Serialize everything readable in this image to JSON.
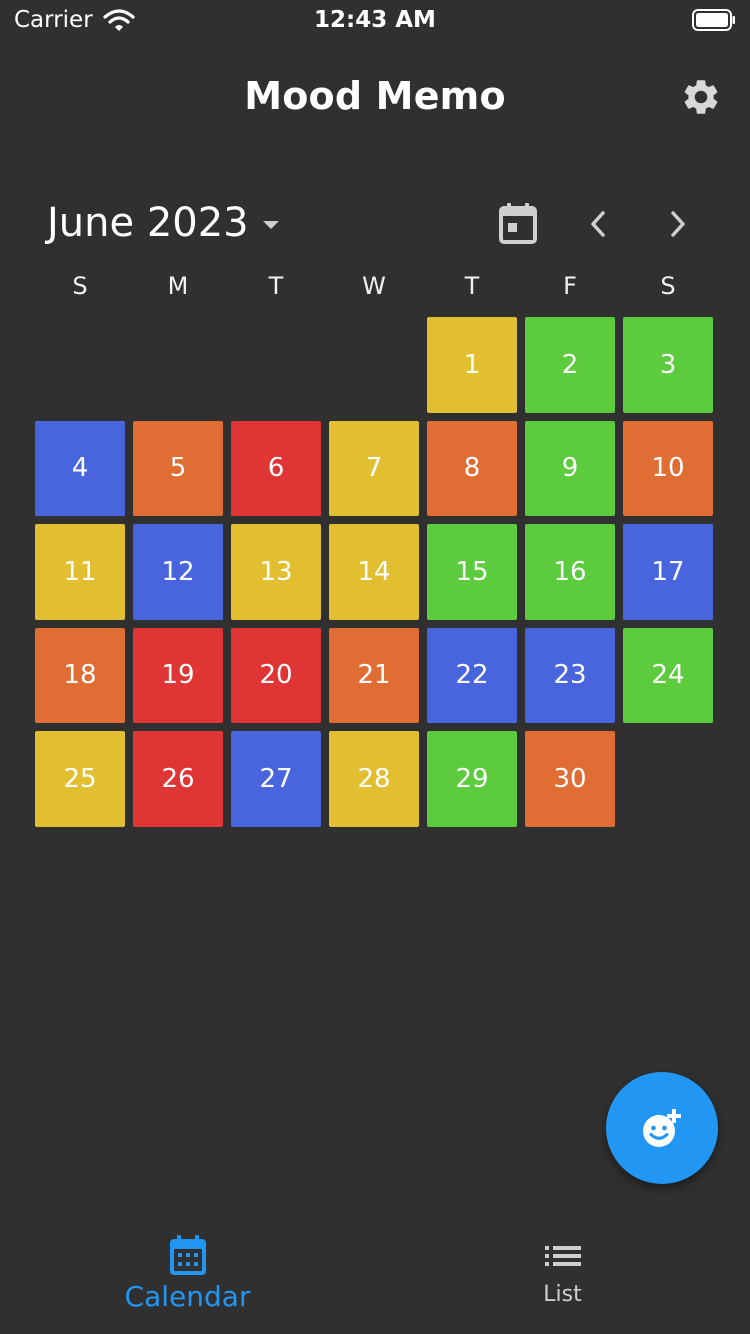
{
  "status_bar": {
    "carrier": "Carrier",
    "time": "12:43 AM",
    "icons": [
      "wifi-icon",
      "battery-icon"
    ]
  },
  "header": {
    "title": "Mood Memo",
    "settings_icon": "gear-icon"
  },
  "calendar": {
    "month_label": "June 2023",
    "icons": {
      "dropdown": "caret-down-icon",
      "today": "calendar-today-icon",
      "prev": "chevron-left-icon",
      "next": "chevron-right-icon"
    },
    "weekdays": [
      "S",
      "M",
      "T",
      "W",
      "T",
      "F",
      "S"
    ],
    "mood_colors": {
      "yellow": "#e2bf31",
      "green": "#5ccb3e",
      "blue": "#4965de",
      "orange": "#e06d34",
      "red": "#e03535"
    },
    "leading_blanks": 4,
    "days": [
      {
        "day": "1",
        "mood": "yellow"
      },
      {
        "day": "2",
        "mood": "green"
      },
      {
        "day": "3",
        "mood": "green"
      },
      {
        "day": "4",
        "mood": "blue"
      },
      {
        "day": "5",
        "mood": "orange"
      },
      {
        "day": "6",
        "mood": "red"
      },
      {
        "day": "7",
        "mood": "yellow"
      },
      {
        "day": "8",
        "mood": "orange"
      },
      {
        "day": "9",
        "mood": "green"
      },
      {
        "day": "10",
        "mood": "orange"
      },
      {
        "day": "11",
        "mood": "yellow"
      },
      {
        "day": "12",
        "mood": "blue"
      },
      {
        "day": "13",
        "mood": "yellow"
      },
      {
        "day": "14",
        "mood": "yellow"
      },
      {
        "day": "15",
        "mood": "green"
      },
      {
        "day": "16",
        "mood": "green"
      },
      {
        "day": "17",
        "mood": "blue"
      },
      {
        "day": "18",
        "mood": "orange"
      },
      {
        "day": "19",
        "mood": "red"
      },
      {
        "day": "20",
        "mood": "red"
      },
      {
        "day": "21",
        "mood": "orange"
      },
      {
        "day": "22",
        "mood": "blue"
      },
      {
        "day": "23",
        "mood": "blue"
      },
      {
        "day": "24",
        "mood": "green"
      },
      {
        "day": "25",
        "mood": "yellow"
      },
      {
        "day": "26",
        "mood": "red"
      },
      {
        "day": "27",
        "mood": "blue"
      },
      {
        "day": "28",
        "mood": "yellow"
      },
      {
        "day": "29",
        "mood": "green"
      },
      {
        "day": "30",
        "mood": "orange"
      }
    ]
  },
  "fab": {
    "icon": "add-mood-icon",
    "color": "#2196f3"
  },
  "bottom_nav": {
    "items": [
      {
        "label": "Calendar",
        "icon": "calendar-icon",
        "active": true
      },
      {
        "label": "List",
        "icon": "list-icon",
        "active": false
      }
    ],
    "active_color": "#2196f3"
  },
  "colors": {
    "background": "#303030",
    "accent": "#2196f3"
  }
}
